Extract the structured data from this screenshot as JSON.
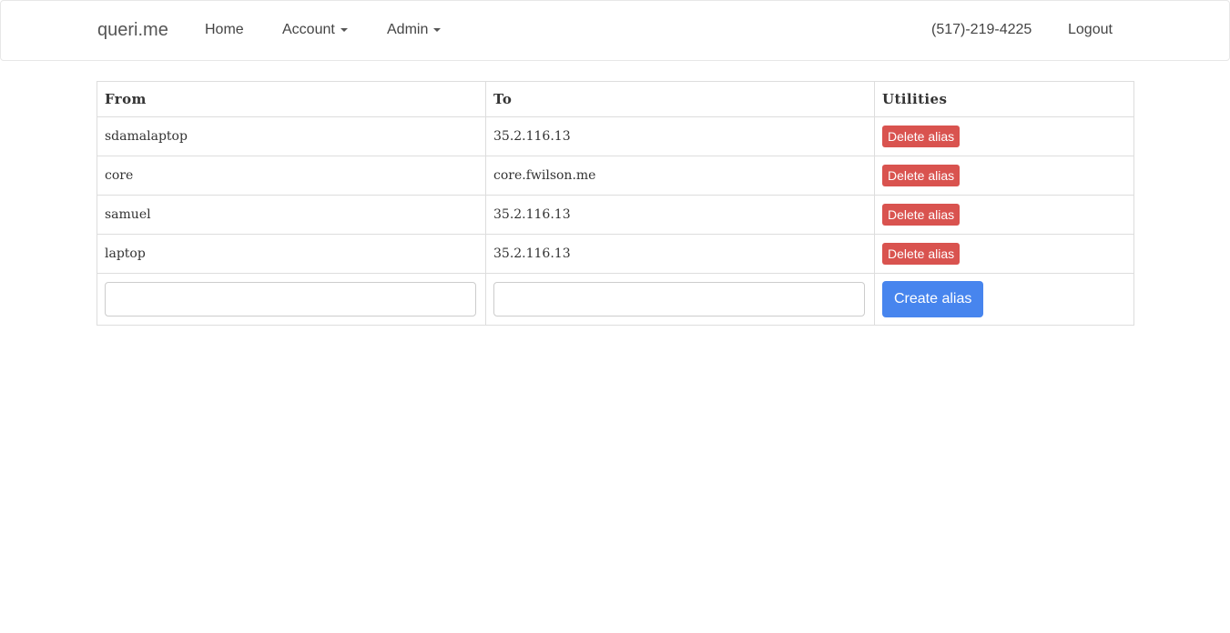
{
  "navbar": {
    "brand": "queri.me",
    "links": {
      "home": "Home",
      "account": "Account",
      "admin": "Admin",
      "phone": "(517)-219-4225",
      "logout": "Logout"
    }
  },
  "table": {
    "headers": {
      "from": "From",
      "to": "To",
      "utilities": "Utilities"
    },
    "rows": [
      {
        "from": "sdamalaptop",
        "to": "35.2.116.13",
        "action": "Delete alias"
      },
      {
        "from": "core",
        "to": "core.fwilson.me",
        "action": "Delete alias"
      },
      {
        "from": "samuel",
        "to": "35.2.116.13",
        "action": "Delete alias"
      },
      {
        "from": "laptop",
        "to": "35.2.116.13",
        "action": "Delete alias"
      }
    ],
    "new_alias": {
      "from_value": "",
      "to_value": "",
      "create_label": "Create alias"
    }
  },
  "colors": {
    "delete_button": "#d9534f",
    "create_button": "#4785ee",
    "border": "#dddddd"
  }
}
